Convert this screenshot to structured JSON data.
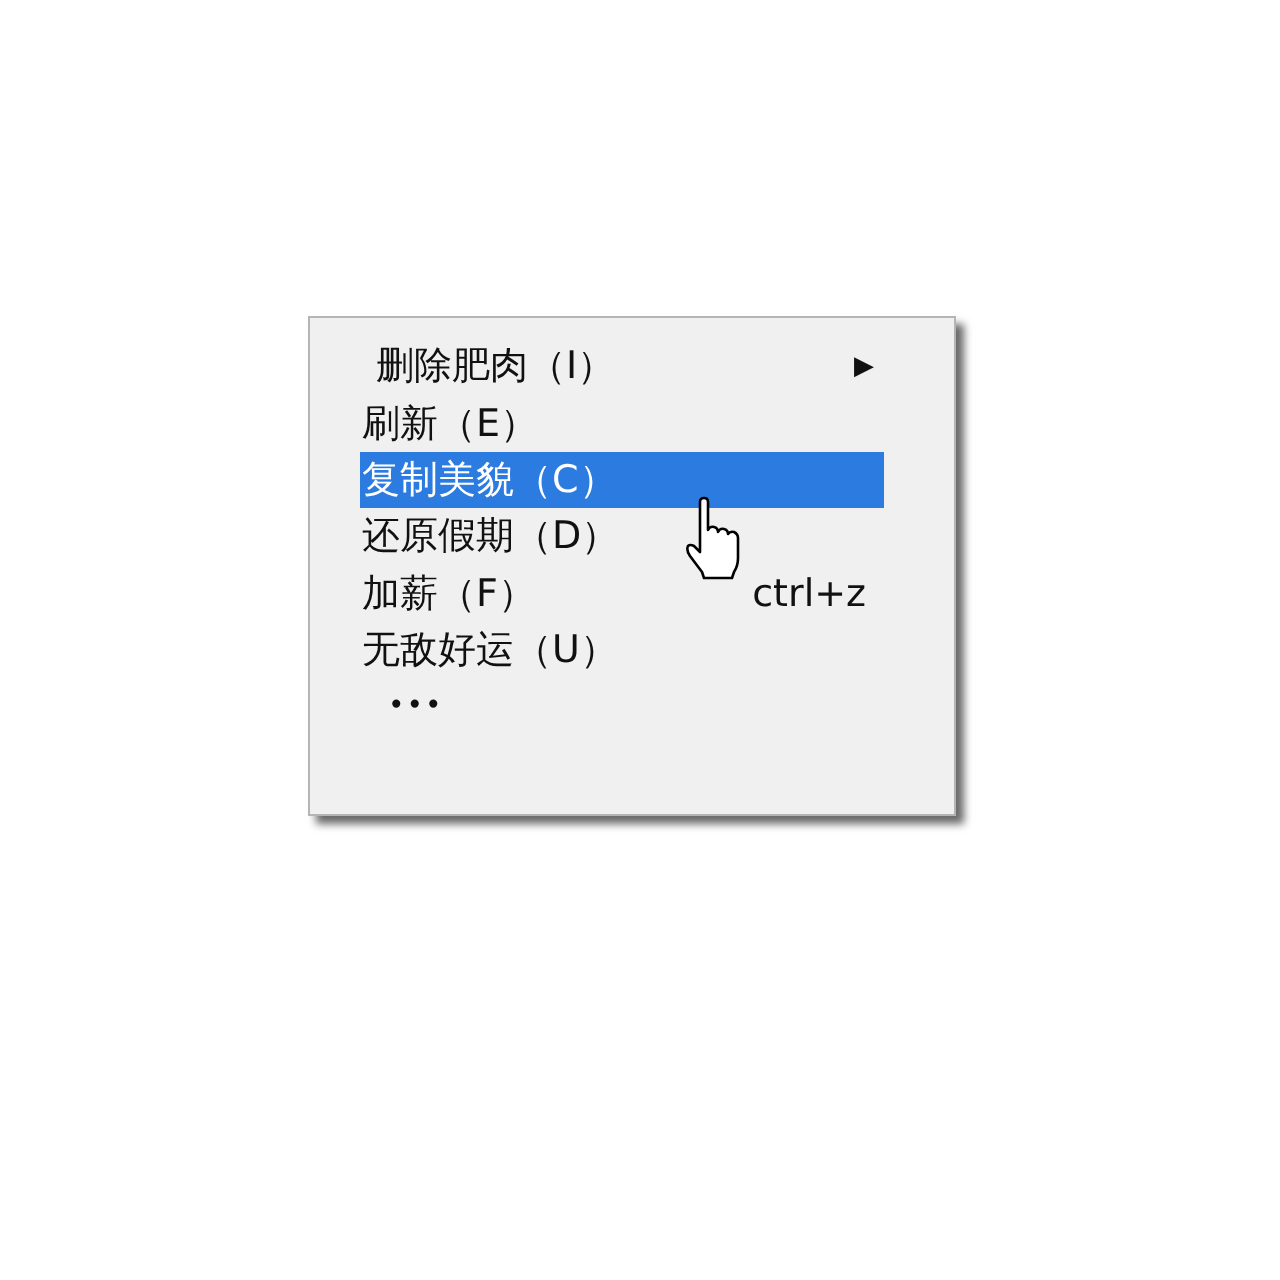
{
  "context_menu": {
    "items": [
      {
        "kind": "command",
        "label": "删除肥肉（I）",
        "selected": false,
        "submenu_arrow": "▶"
      },
      {
        "kind": "command",
        "label": "刷新（E）",
        "selected": false
      },
      {
        "kind": "command",
        "label": "复制美貌（C）",
        "selected": true
      },
      {
        "kind": "command",
        "label": "还原假期（D）",
        "selected": false
      },
      {
        "kind": "command",
        "label": "加薪（F）",
        "selected": false,
        "shortcut": "ctrl+z"
      },
      {
        "kind": "command",
        "label": "无敌好运（U）",
        "selected": false
      },
      {
        "kind": "more",
        "label": "•••"
      }
    ]
  }
}
